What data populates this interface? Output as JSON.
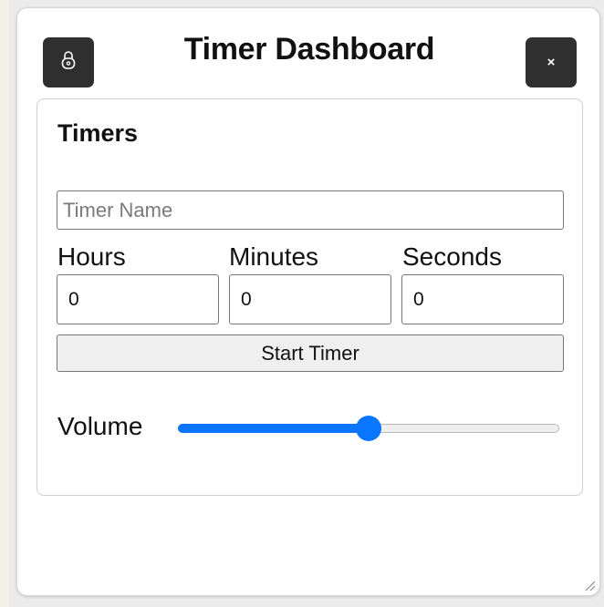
{
  "header": {
    "title": "Timer Dashboard",
    "close_label": "×",
    "lock_icon": "lock-icon"
  },
  "timers": {
    "section_title": "Timers",
    "name_input": {
      "placeholder": "Timer Name",
      "value": ""
    },
    "hours": {
      "label": "Hours",
      "value": "0"
    },
    "minutes": {
      "label": "Minutes",
      "value": "0"
    },
    "seconds": {
      "label": "Seconds",
      "value": "0"
    },
    "start_label": "Start Timer",
    "volume": {
      "label": "Volume",
      "level": 0.5
    }
  },
  "colors": {
    "accent": "#0a75ff",
    "icon_button_bg": "#2f2f2f"
  }
}
